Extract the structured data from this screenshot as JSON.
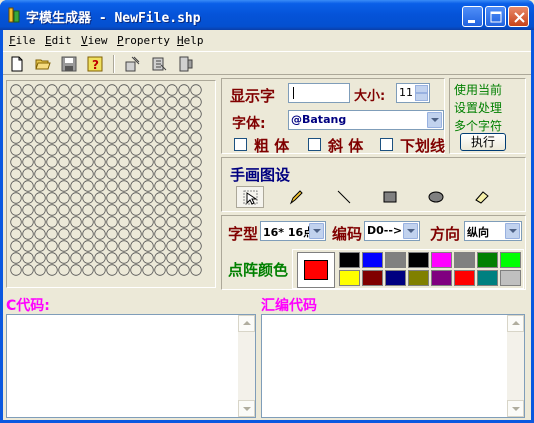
{
  "window": {
    "title": "字模生成器 - NewFile.shp",
    "min_label": "minimize",
    "max_label": "maximize",
    "close_label": "close"
  },
  "menu": [
    "File",
    "Edit",
    "View",
    "Property",
    "Help"
  ],
  "toolbar": {
    "icons": [
      "new-file-icon",
      "open-folder-icon",
      "save-disk-icon",
      "help-icon",
      "tool-a-icon",
      "tool-b-icon",
      "tool-c-icon"
    ]
  },
  "grid": {
    "rows": 16,
    "cols": 16
  },
  "font_panel": {
    "display_char_label": "显示字",
    "display_char_value": "",
    "size_label": "大小:",
    "size_value": "11",
    "font_label": "字体:",
    "font_value": "@Batang",
    "bold_label": "粗  体",
    "italic_label": "斜  体",
    "underline_label": "下划线"
  },
  "hint": {
    "line1": "使用当前",
    "line2": "设置处理",
    "line3": "多个字符",
    "execute_label": "执行"
  },
  "draw_panel": {
    "title": "手画图设",
    "tools": [
      "select-arrow-icon",
      "pencil-icon",
      "line-icon",
      "rectangle-icon",
      "ellipse-icon",
      "eraser-icon"
    ]
  },
  "options": {
    "font_type_label": "字型",
    "font_type_value": "16* 16点",
    "encoding_label": "编码",
    "encoding_value": "D0-->D",
    "direction_label": "方向",
    "direction_value": "纵向",
    "dot_color_label": "点阵颜色",
    "current_color": "#ff0000",
    "palette": [
      "#000000",
      "#0000ff",
      "#808080",
      "#000000",
      "#ff00ff",
      "#808080",
      "#008000",
      "#00ff00",
      "#ffff00",
      "#800000",
      "#000080",
      "#808000",
      "#800080",
      "#ff0000",
      "#008080",
      "#c0c0c0"
    ]
  },
  "code": {
    "c_label": "C代码:",
    "asm_label": "汇编代码"
  }
}
